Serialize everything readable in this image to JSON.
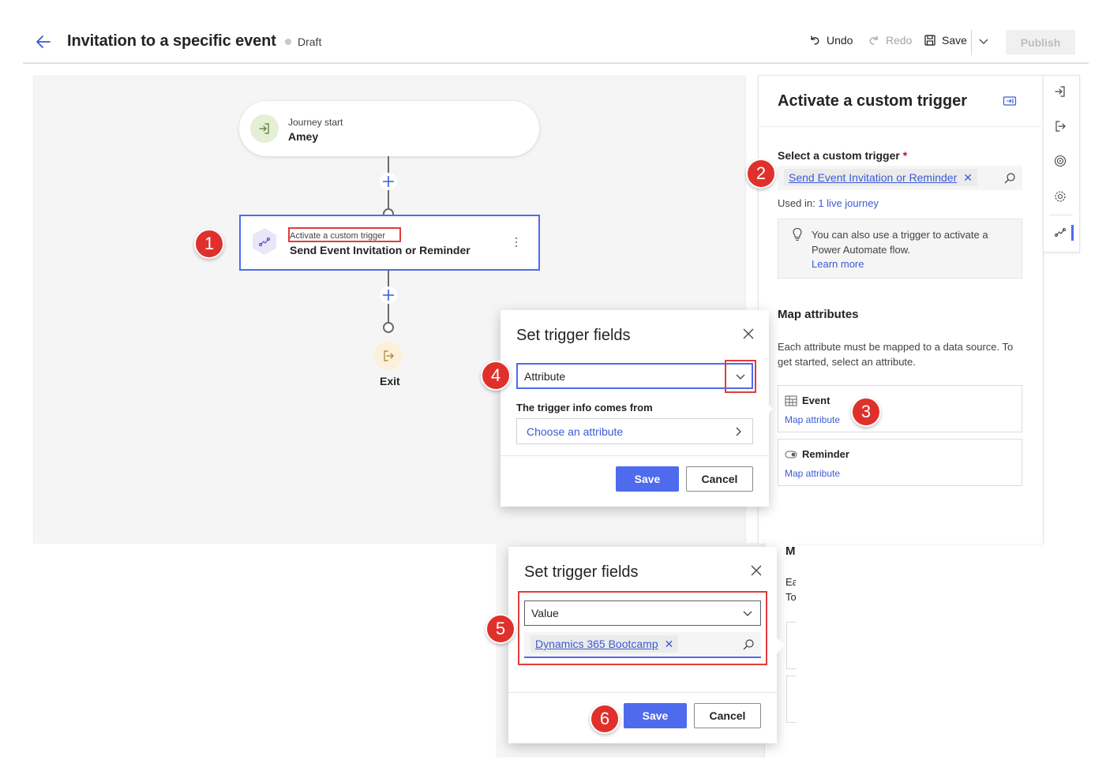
{
  "header": {
    "title": "Invitation to a specific event",
    "status": "Draft",
    "undo_label": "Undo",
    "redo_label": "Redo",
    "save_label": "Save",
    "publish_label": "Publish"
  },
  "canvas": {
    "start": {
      "caption": "Journey start",
      "name": "Amey"
    },
    "trigger_node": {
      "caption": "Activate a custom trigger",
      "name": "Send Event Invitation or Reminder"
    },
    "exit_label": "Exit"
  },
  "panel": {
    "title": "Activate a custom trigger",
    "select_label": "Select a custom trigger",
    "required_mark": "*",
    "selected_trigger": "Send Event Invitation or Reminder",
    "remove_glyph": "✕",
    "used_in_prefix": "Used in:",
    "used_in_link": "1 live journey",
    "info_text": "You can also use a trigger to activate a Power Automate flow.",
    "learn_more": "Learn more",
    "map_title": "Map attributes",
    "map_desc": "Each attribute must be mapped to a data source. To get started, select an attribute.",
    "attributes": [
      {
        "name": "Event",
        "link": "Map attribute",
        "icon": "table-icon"
      },
      {
        "name": "Reminder",
        "link": "Map attribute",
        "icon": "toggle-icon"
      }
    ],
    "lower_fragments": {
      "m": "M",
      "ea": "Ea",
      "to": "To"
    }
  },
  "dialog_1": {
    "title": "Set trigger fields",
    "dropdown_value": "Attribute",
    "source_label": "The trigger info comes from",
    "source_placeholder": "Choose an attribute",
    "save_label": "Save",
    "cancel_label": "Cancel"
  },
  "dialog_2": {
    "title": "Set trigger fields",
    "dropdown_value": "Value",
    "chip_value": "Dynamics 365 Bootcamp",
    "save_label": "Save",
    "cancel_label": "Cancel"
  },
  "badges": [
    "1",
    "2",
    "3",
    "4",
    "5",
    "6"
  ],
  "colors": {
    "accent": "#4f6bed",
    "badge": "#e0302c",
    "link": "#3b5bd6"
  }
}
